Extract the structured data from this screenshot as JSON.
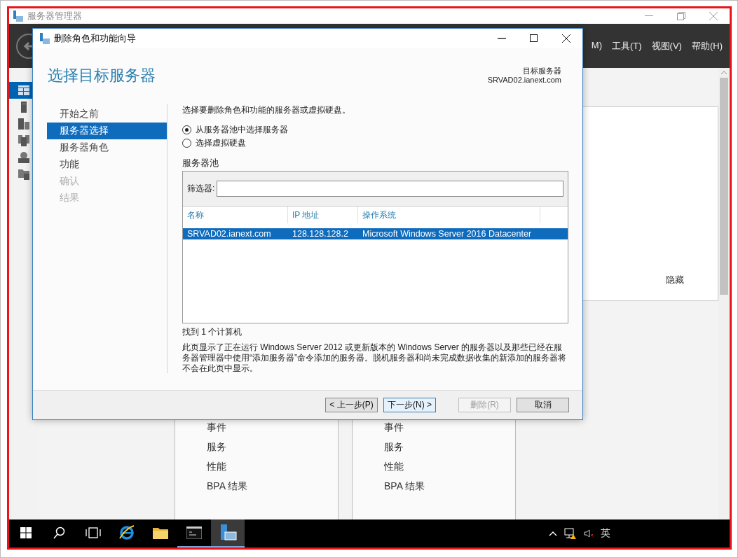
{
  "manager": {
    "title": "服务器管理器",
    "menu": [
      "M)",
      "工具(T)",
      "视图(V)",
      "帮助(H)"
    ],
    "sidebar": [
      {
        "kind": "dashboard",
        "selected": true
      },
      {
        "kind": "server",
        "selected": false
      },
      {
        "kind": "servers",
        "selected": false
      },
      {
        "kind": "roles",
        "selected": false
      },
      {
        "kind": "web",
        "selected": false
      },
      {
        "kind": "files",
        "selected": false
      }
    ],
    "panel_link": "隐藏",
    "tiles": [
      {
        "items": [
          "事件",
          "服务",
          "性能",
          "BPA 结果"
        ]
      },
      {
        "items": [
          "事件",
          "服务",
          "性能",
          "BPA 结果"
        ]
      }
    ]
  },
  "dialog": {
    "title": "删除角色和功能向导",
    "heading": "选择目标服务器",
    "target_label": "目标服务器",
    "target_server": "SRVAD02.ianext.com",
    "steps": [
      {
        "label": "开始之前",
        "selected": false,
        "disabled": false
      },
      {
        "label": "服务器选择",
        "selected": true,
        "disabled": false
      },
      {
        "label": "服务器角色",
        "selected": false,
        "disabled": false
      },
      {
        "label": "功能",
        "selected": false,
        "disabled": false
      },
      {
        "label": "确认",
        "selected": false,
        "disabled": true
      },
      {
        "label": "结果",
        "selected": false,
        "disabled": true
      }
    ],
    "intro": "选择要删除角色和功能的服务器或虚拟硬盘。",
    "options": [
      {
        "label": "从服务器池中选择服务器",
        "selected": true
      },
      {
        "label": "选择虚拟硬盘",
        "selected": false
      }
    ],
    "pool_title": "服务器池",
    "filter_label": "筛选器:",
    "columns": [
      "名称",
      "IP 地址",
      "操作系统"
    ],
    "rows": [
      {
        "cells": [
          "SRVAD02.ianext.com",
          "128.128.128.2",
          "Microsoft Windows Server 2016 Datacenter"
        ],
        "selected": true
      }
    ],
    "count": "找到 1 个计算机",
    "note": "此页显示了正在运行 Windows Server 2012 或更新版本的 Windows Server 的服务器以及那些已经在服务器管理器中使用“添加服务器”命令添加的服务器。脱机服务器和尚未完成数据收集的新添加的服务器将不会在此页中显示。",
    "buttons": [
      {
        "label": "< 上一步(P)",
        "kind": "normal",
        "disabled": false
      },
      {
        "label": "下一步(N) >",
        "kind": "default",
        "disabled": false
      },
      {
        "label": "删除(R)",
        "kind": "normal",
        "disabled": true
      },
      {
        "label": "取消",
        "kind": "normal",
        "disabled": false
      }
    ]
  },
  "taskbar": {
    "apps": [
      {
        "kind": "start",
        "active": false,
        "running": false
      },
      {
        "kind": "search",
        "active": false,
        "running": false
      },
      {
        "kind": "taskview",
        "active": false,
        "running": false
      },
      {
        "kind": "browser",
        "active": false,
        "running": false
      },
      {
        "kind": "folder",
        "active": false,
        "running": false
      },
      {
        "kind": "console",
        "active": false,
        "running": true
      },
      {
        "kind": "server-manager",
        "active": true,
        "running": true
      }
    ],
    "ime": "英"
  }
}
